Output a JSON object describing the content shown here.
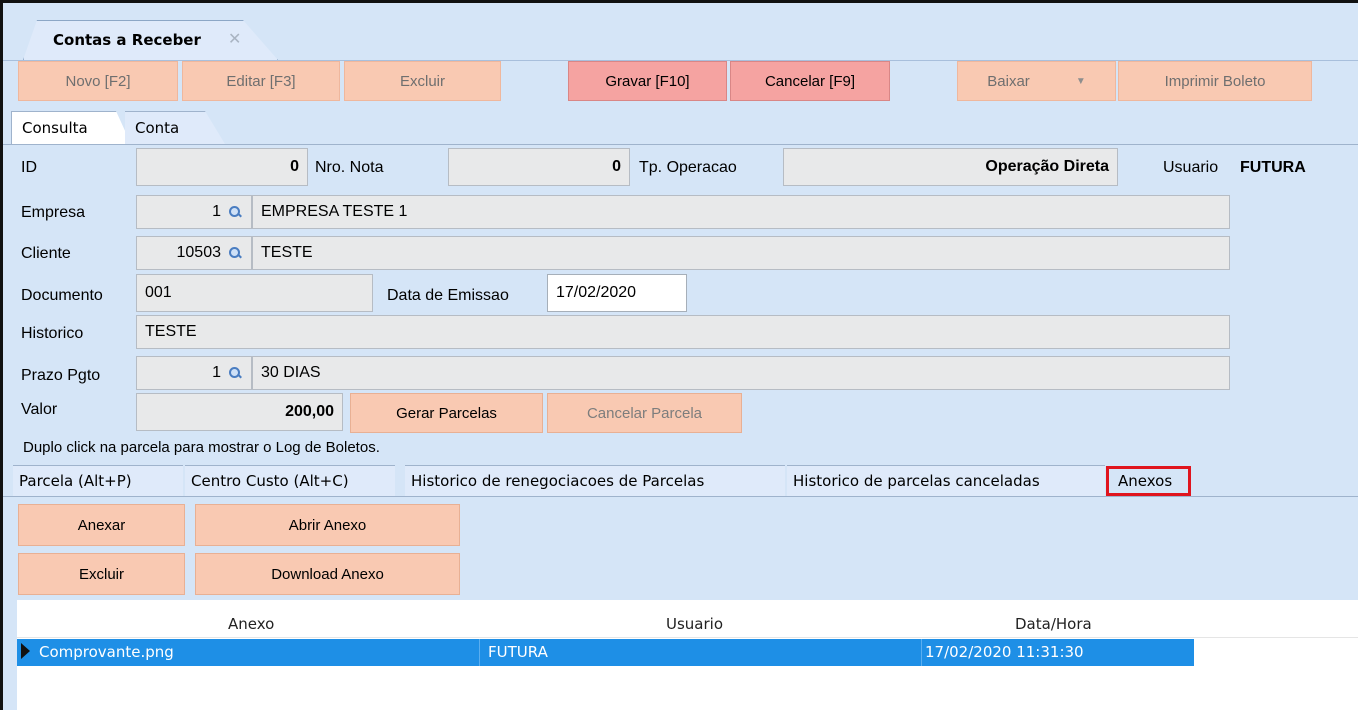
{
  "window": {
    "doc_tab": "Contas a Receber",
    "close_glyph": "✕"
  },
  "toolbar": {
    "novo": "Novo [F2]",
    "editar": "Editar [F3]",
    "excluir": "Excluir",
    "gravar": "Gravar [F10]",
    "cancelar": "Cancelar [F9]",
    "baixar": "Baixar",
    "imprimir": "Imprimir Boleto"
  },
  "page_tabs": [
    "Consulta",
    "Conta"
  ],
  "form": {
    "id_label": "ID",
    "id_value": "0",
    "nota_label": "Nro. Nota",
    "nota_value": "0",
    "tpop_label": "Tp. Operacao",
    "tpop_value": "Operação Direta",
    "usuario_label": "Usuario",
    "usuario_value": "FUTURA",
    "empresa_label": "Empresa",
    "empresa_code": "1",
    "empresa_name": "EMPRESA TESTE 1",
    "cliente_label": "Cliente",
    "cliente_code": "10503",
    "cliente_name": "TESTE",
    "documento_label": "Documento",
    "documento_value": "001",
    "emissao_label": "Data de Emissao",
    "emissao_value": "17/02/2020",
    "historico_label": "Historico",
    "historico_value": "TESTE",
    "prazo_label": "Prazo Pgto",
    "prazo_code": "1",
    "prazo_name": "30 DIAS",
    "valor_label": "Valor",
    "valor_value": "200,00",
    "gerar_parcelas": "Gerar Parcelas",
    "cancelar_parcela": "Cancelar Parcela",
    "hint": "Duplo click na parcela para mostrar o Log de Boletos."
  },
  "sub_tabs": [
    "Parcela (Alt+P)",
    "Centro Custo (Alt+C)",
    "Historico de renegociacoes de Parcelas",
    "Historico de parcelas canceladas",
    "Anexos"
  ],
  "anexos": {
    "anexar": "Anexar",
    "abrir": "Abrir Anexo",
    "excluir": "Excluir",
    "download": "Download Anexo",
    "columns": [
      "Anexo",
      "Usuario",
      "Data/Hora"
    ],
    "rows": [
      {
        "anexo": "Comprovante.png",
        "usuario": "FUTURA",
        "data_hora": "17/02/2020 11:31:30"
      }
    ]
  },
  "colors": {
    "window_bg": "#d5e5f7",
    "button_peach": "#f9c9b2",
    "button_active": "#f5a3a1",
    "selected_row": "#1e8fe6",
    "highlight_box": "#e0141e"
  }
}
